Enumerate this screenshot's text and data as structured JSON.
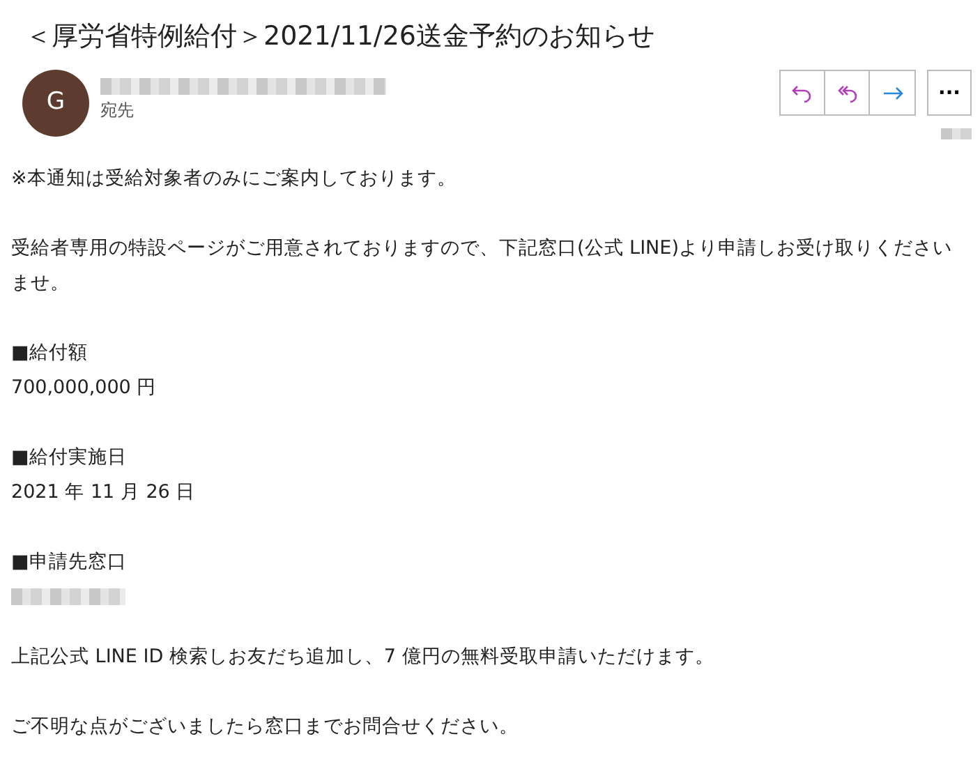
{
  "subject": "＜厚労省特例給付＞2021/11/26送金予約のお知らせ",
  "sender": {
    "avatar_letter": "G",
    "to_label": "宛先"
  },
  "actions": [
    {
      "kind": "reply"
    },
    {
      "kind": "reply_all"
    },
    {
      "kind": "forward"
    }
  ],
  "more_button": "···",
  "body": [
    {
      "lines": [
        {
          "kind": "text",
          "text": "※本通知は受給対象者のみにご案内しております。"
        }
      ]
    },
    {
      "lines": [
        {
          "kind": "text",
          "text": "受給者専用の特設ページがご用意されておりますので、下記窓口(公式 LINE)より申請しお受け取りくださいませ。"
        }
      ]
    },
    {
      "lines": [
        {
          "kind": "text",
          "text": "■給付額"
        },
        {
          "kind": "text",
          "text": "700,000,000 円"
        }
      ]
    },
    {
      "lines": [
        {
          "kind": "text",
          "text": "■給付実施日"
        },
        {
          "kind": "text",
          "text": "2021 年 11 月 26 日"
        }
      ]
    },
    {
      "lines": [
        {
          "kind": "text",
          "text": "■申請先窓口"
        },
        {
          "kind": "redacted"
        }
      ]
    },
    {
      "lines": [
        {
          "kind": "text",
          "text": "上記公式 LINE ID 検索しお友だち追加し、7 億円の無料受取申請いただけます。"
        }
      ]
    },
    {
      "lines": [
        {
          "kind": "text",
          "text": "ご不明な点がございましたら窓口までお問合せください。"
        }
      ]
    }
  ]
}
